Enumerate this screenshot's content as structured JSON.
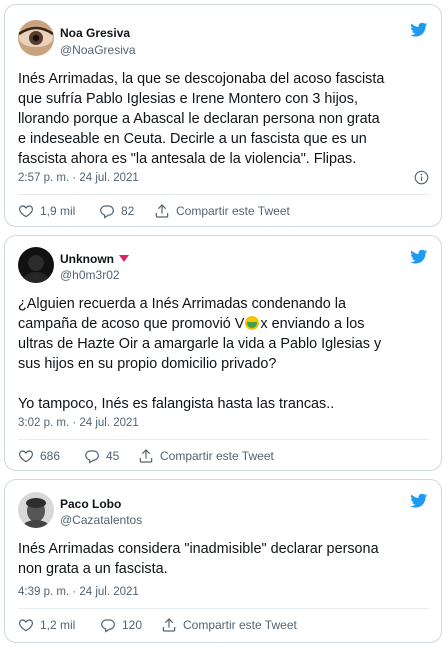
{
  "tweets": [
    {
      "name": "Noa Gresiva",
      "handle": "@NoaGresiva",
      "text": "Inés Arrimadas, la que se descojonaba del acoso fascista\nque sufría Pablo Iglesias e Irene Montero con 3 hijos,\nllorando porque a Abascal le declaran persona non grata\ne indeseable en Ceuta. Decirle a un fascista que es un\nfascista ahora es \"la antesala de la violencia\". Flipas.",
      "time": "2:57 p. m. · 24 jul. 2021",
      "likes": "1,9 mil",
      "replies": "82",
      "share": "Compartir este Tweet"
    },
    {
      "name": "Unknown",
      "handle": "@h0m3r02",
      "text_before_emoji": "¿Alguien recuerda a Inés Arrimadas condenando la\ncampaña de acoso que promovió V",
      "text_after_emoji": "x enviando a los\nultras de Hazte Oir a amargarle la vida a Pablo Iglesias y\nsus hijos en su propio domicilio privado?\n\nYo tampoco, Inés es falangista hasta las trancas..",
      "time": "3:02 p. m. · 24 jul. 2021",
      "likes": "686",
      "replies": "45",
      "share": "Compartir este Tweet"
    },
    {
      "name": "Paco Lobo",
      "handle": "@Cazatalentos",
      "text": "Inés Arrimadas considera \"inadmisible\" declarar persona\nnon grata a un fascista.",
      "time": "4:39 p. m. · 24 jul. 2021",
      "likes": "1,2 mil",
      "replies": "120",
      "share": "Compartir este Tweet"
    }
  ],
  "icons": {
    "brand": "twitter-bird-icon",
    "like": "heart-icon",
    "reply": "reply-bubble-icon",
    "share": "share-icon",
    "info": "info-icon"
  },
  "colors": {
    "brand_blue": "#1d9bf0",
    "text_primary": "#0f1419",
    "text_secondary": "#536471",
    "border": "#cfd9de",
    "flag_triangle": "#e0245e"
  }
}
